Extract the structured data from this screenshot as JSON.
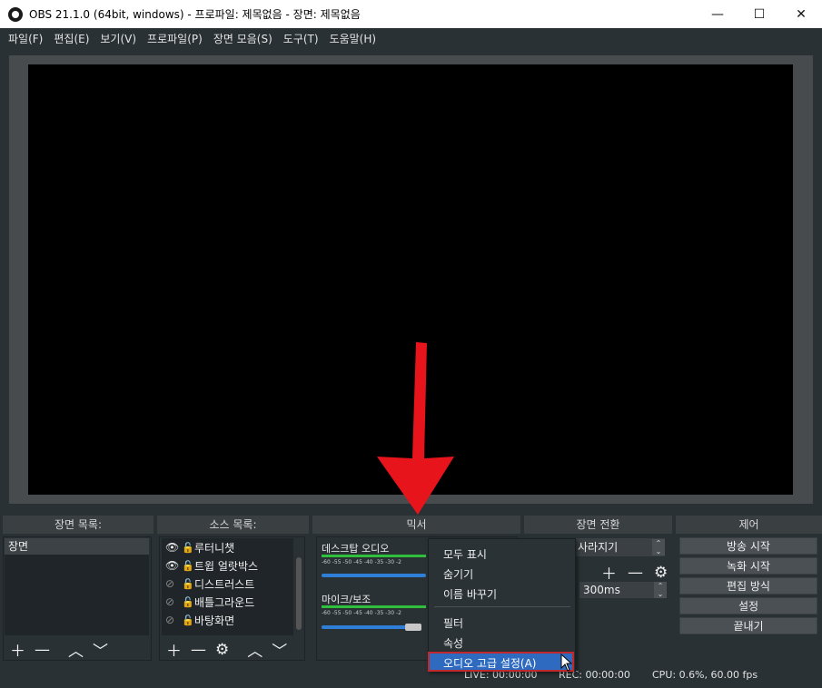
{
  "window": {
    "title": "OBS 21.1.0 (64bit, windows) - 프로파일: 제목없음 - 장면: 제목없음",
    "minimize": "—",
    "maximize": "☐",
    "close": "✕"
  },
  "menu": [
    "파일(F)",
    "편집(E)",
    "보기(V)",
    "프로파일(P)",
    "장면 모음(S)",
    "도구(T)",
    "도움말(H)"
  ],
  "docks": {
    "scenes": "장면 목록:",
    "sources": "소스 목록:",
    "mixer": "믹서",
    "transitions": "장면 전환",
    "controls": "제어"
  },
  "scenes": [
    "장면"
  ],
  "sources": [
    {
      "name": "루터니챗",
      "visible": true
    },
    {
      "name": "트윕 얼랏박스",
      "visible": true
    },
    {
      "name": "디스트러스트",
      "visible": false
    },
    {
      "name": "배틀그라운드",
      "visible": false
    },
    {
      "name": "바탕화면",
      "visible": false
    }
  ],
  "mixer": {
    "tracks": [
      {
        "name": "데스크탑 오디오",
        "level": 0.84
      },
      {
        "name": "마이크/보조",
        "level": 0.84
      }
    ],
    "scale": "-60 -55 -50 -45 -40 -35 -30 -2"
  },
  "transition": {
    "type": "사라지기",
    "duration": "300ms"
  },
  "controls": [
    "방송 시작",
    "녹화 시작",
    "편집 방식",
    "설정",
    "끝내기"
  ],
  "context_menu": {
    "items": [
      "모두 표시",
      "숨기기",
      "이름 바꾸기",
      "필터",
      "속성",
      "오디오 고급 설정(A)"
    ],
    "highlighted": "오디오 고급 설정(A)"
  },
  "status": {
    "live": "LIVE: 00:00:00",
    "rec": "REC: 00:00:00",
    "cpu": "CPU: 0.6%, 60.00 fps"
  },
  "colors": {
    "background": "#293134",
    "highlight": "#2e6bc0",
    "arrow": "#e8141b",
    "meter": "#2fbf3c"
  }
}
